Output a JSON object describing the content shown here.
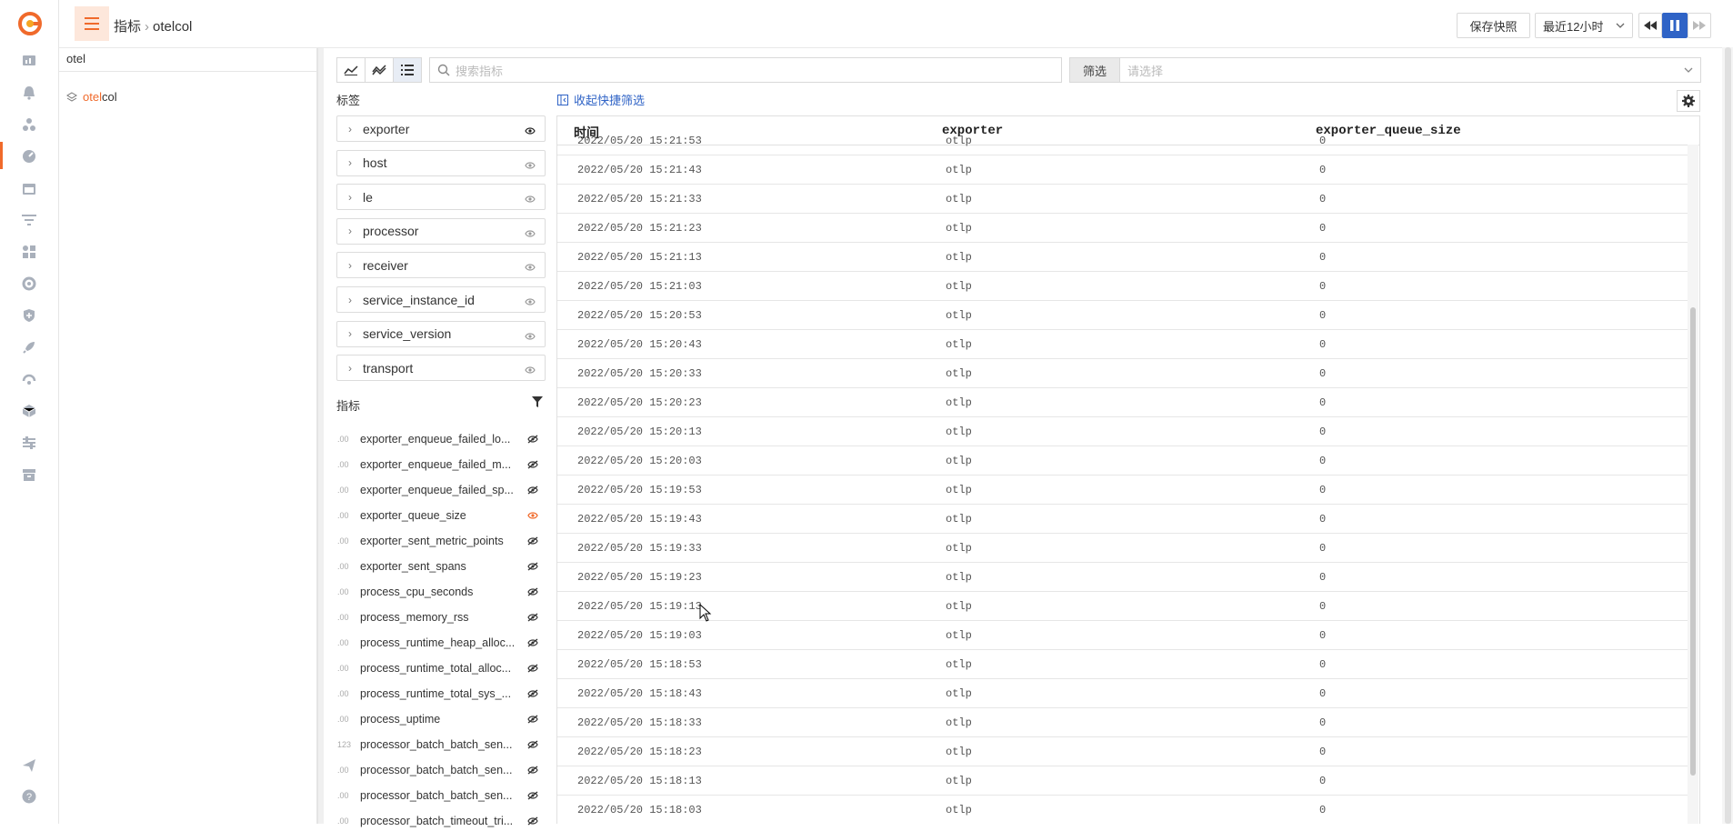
{
  "header": {
    "breadcrumb_parent": "指标",
    "breadcrumb_current": "otelcol",
    "save_snapshot": "保存快照",
    "time_range": "最近12小时"
  },
  "tree": {
    "search_value": "otel",
    "node_highlight": "otel",
    "node_rest": "col"
  },
  "toolbar": {
    "search_placeholder": "搜索指标",
    "filter_label": "筛选",
    "filter_placeholder": "请选择",
    "collapse_quick_filter": "收起快捷筛选"
  },
  "tags_title": "标签",
  "tags": [
    "exporter",
    "host",
    "le",
    "processor",
    "receiver",
    "service_instance_id",
    "service_version",
    "transport"
  ],
  "metrics_title": "指标",
  "metrics": [
    {
      "prefix": ".00",
      "name": "exporter_enqueue_failed_lo..."
    },
    {
      "prefix": ".00",
      "name": "exporter_enqueue_failed_m..."
    },
    {
      "prefix": ".00",
      "name": "exporter_enqueue_failed_sp..."
    },
    {
      "prefix": ".00",
      "name": "exporter_queue_size"
    },
    {
      "prefix": ".00",
      "name": "exporter_sent_metric_points"
    },
    {
      "prefix": ".00",
      "name": "exporter_sent_spans"
    },
    {
      "prefix": ".00",
      "name": "process_cpu_seconds"
    },
    {
      "prefix": ".00",
      "name": "process_memory_rss"
    },
    {
      "prefix": ".00",
      "name": "process_runtime_heap_alloc..."
    },
    {
      "prefix": ".00",
      "name": "process_runtime_total_alloc..."
    },
    {
      "prefix": ".00",
      "name": "process_runtime_total_sys_..."
    },
    {
      "prefix": ".00",
      "name": "process_uptime"
    },
    {
      "prefix": "123",
      "name": "processor_batch_batch_sen..."
    },
    {
      "prefix": ".00",
      "name": "processor_batch_batch_sen..."
    },
    {
      "prefix": ".00",
      "name": "processor_batch_batch_sen..."
    },
    {
      "prefix": ".00",
      "name": "processor_batch_timeout_tri..."
    }
  ],
  "table": {
    "columns": [
      "时间",
      "exporter",
      "exporter_queue_size"
    ],
    "rows": [
      [
        "2022/05/20 15:21:53",
        "otlp",
        "0"
      ],
      [
        "2022/05/20 15:21:43",
        "otlp",
        "0"
      ],
      [
        "2022/05/20 15:21:33",
        "otlp",
        "0"
      ],
      [
        "2022/05/20 15:21:23",
        "otlp",
        "0"
      ],
      [
        "2022/05/20 15:21:13",
        "otlp",
        "0"
      ],
      [
        "2022/05/20 15:21:03",
        "otlp",
        "0"
      ],
      [
        "2022/05/20 15:20:53",
        "otlp",
        "0"
      ],
      [
        "2022/05/20 15:20:43",
        "otlp",
        "0"
      ],
      [
        "2022/05/20 15:20:33",
        "otlp",
        "0"
      ],
      [
        "2022/05/20 15:20:23",
        "otlp",
        "0"
      ],
      [
        "2022/05/20 15:20:13",
        "otlp",
        "0"
      ],
      [
        "2022/05/20 15:20:03",
        "otlp",
        "0"
      ],
      [
        "2022/05/20 15:19:53",
        "otlp",
        "0"
      ],
      [
        "2022/05/20 15:19:43",
        "otlp",
        "0"
      ],
      [
        "2022/05/20 15:19:33",
        "otlp",
        "0"
      ],
      [
        "2022/05/20 15:19:23",
        "otlp",
        "0"
      ],
      [
        "2022/05/20 15:19:13",
        "otlp",
        "0"
      ],
      [
        "2022/05/20 15:19:03",
        "otlp",
        "0"
      ],
      [
        "2022/05/20 15:18:53",
        "otlp",
        "0"
      ],
      [
        "2022/05/20 15:18:43",
        "otlp",
        "0"
      ],
      [
        "2022/05/20 15:18:33",
        "otlp",
        "0"
      ],
      [
        "2022/05/20 15:18:23",
        "otlp",
        "0"
      ],
      [
        "2022/05/20 15:18:13",
        "otlp",
        "0"
      ],
      [
        "2022/05/20 15:18:03",
        "otlp",
        "0"
      ]
    ]
  },
  "colors": {
    "accent": "#f06a2b",
    "link": "#2f63c6",
    "play": "#2f63c6"
  },
  "rail_icons": [
    "dashboard-icon",
    "alarm-bell-icon",
    "topology-icon",
    "metrics-gauge-icon",
    "calendar-icon",
    "filter-list-icon",
    "apps-grid-icon",
    "satellite-icon",
    "security-shield-icon",
    "rocket-icon",
    "network-signal-icon",
    "cube-icon",
    "sliders-icon",
    "archive-icon",
    "send-icon",
    "help-icon"
  ]
}
